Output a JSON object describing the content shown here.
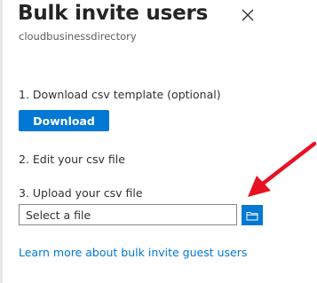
{
  "panel": {
    "title": "Bulk invite users",
    "subtitle": "cloudbusinessdirectory"
  },
  "steps": {
    "step1_label": "1. Download csv template (optional)",
    "download_button": "Download",
    "step2_label": "2. Edit your csv file",
    "step3_label": "3. Upload your csv file",
    "file_input_value": "Select a file"
  },
  "learn_more_link": "Learn more about bulk invite guest users",
  "icons": {
    "close": "close-icon",
    "browse": "folder-icon",
    "annotation": "red-arrow"
  },
  "colors": {
    "accent": "#0078d4",
    "annotation_arrow": "#e81123"
  }
}
